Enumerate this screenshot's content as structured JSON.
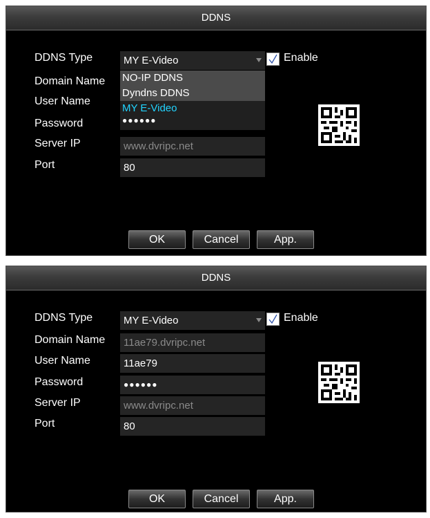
{
  "dialogs": [
    {
      "title": "DDNS",
      "ddns_type": {
        "label": "DDNS Type",
        "value": "MY E-Video"
      },
      "enable": {
        "label": "Enable",
        "checked": true
      },
      "domain_name": {
        "label": "Domain Name",
        "value": ""
      },
      "user_name": {
        "label": "User Name",
        "value": ""
      },
      "password": {
        "label": "Password",
        "value": "●●●●●●"
      },
      "server_ip": {
        "label": "Server IP",
        "value": "www.dvripc.net"
      },
      "port": {
        "label": "Port",
        "value": "80"
      },
      "dropdown_open": true,
      "dropdown_options": [
        "NO-IP DDNS",
        "Dyndns DDNS",
        "MY E-Video"
      ],
      "dropdown_selected": "MY E-Video",
      "buttons": {
        "ok": "OK",
        "cancel": "Cancel",
        "apply": "App."
      }
    },
    {
      "title": "DDNS",
      "ddns_type": {
        "label": "DDNS Type",
        "value": "MY E-Video"
      },
      "enable": {
        "label": "Enable",
        "checked": true
      },
      "domain_name": {
        "label": "Domain Name",
        "value": "11ae79.dvripc.net"
      },
      "user_name": {
        "label": "User Name",
        "value": "11ae79"
      },
      "password": {
        "label": "Password",
        "value": "●●●●●●"
      },
      "server_ip": {
        "label": "Server IP",
        "value": "www.dvripc.net"
      },
      "port": {
        "label": "Port",
        "value": "80"
      },
      "dropdown_open": false,
      "buttons": {
        "ok": "OK",
        "cancel": "Cancel",
        "apply": "App."
      }
    }
  ],
  "icons": {
    "checkbox_mark": "check-icon",
    "qr_code": "qr-code-icon"
  },
  "colors": {
    "dialog_bg": "#000000",
    "field_bg": "#252525",
    "selected_option": "#22d4ff",
    "disabled_text": "#8a8a8a"
  }
}
